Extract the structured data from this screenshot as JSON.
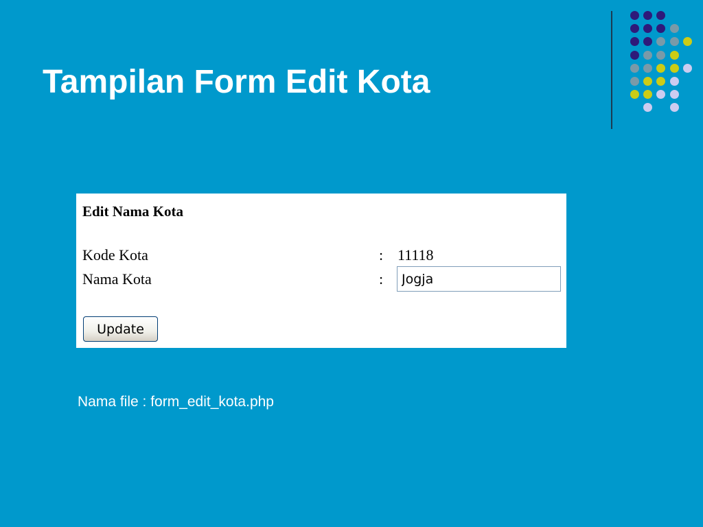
{
  "slide": {
    "title": "Tampilan Form Edit Kota",
    "footnote": "Nama file : form_edit_kota.php"
  },
  "form": {
    "heading": "Edit Nama Kota",
    "kode_label": "Kode Kota",
    "kode_value": "11118",
    "nama_label": "Nama Kota",
    "nama_value": "Jogja",
    "separator": ":",
    "update_label": "Update"
  },
  "decoration": {
    "dot_grid": [
      [
        "purple",
        "purple",
        "purple",
        "",
        ""
      ],
      [
        "purple",
        "purple",
        "purple",
        "gray",
        ""
      ],
      [
        "purple",
        "purple",
        "gray",
        "gray",
        "yellow"
      ],
      [
        "purple",
        "gray",
        "gray",
        "yellow",
        ""
      ],
      [
        "gray",
        "gray",
        "yellow",
        "yellow",
        "lavender"
      ],
      [
        "gray",
        "yellow",
        "yellow",
        "lavender",
        ""
      ],
      [
        "yellow",
        "yellow",
        "lavender",
        "lavender",
        ""
      ],
      [
        "",
        "lavender",
        "",
        "lavender",
        ""
      ]
    ],
    "colors": {
      "background": "#0099cc",
      "purple": "#2e1a7a",
      "gray": "#7a9aa8",
      "yellow": "#cccc16",
      "lavender": "#ccccf0",
      "divider": "#1b3b52"
    }
  }
}
